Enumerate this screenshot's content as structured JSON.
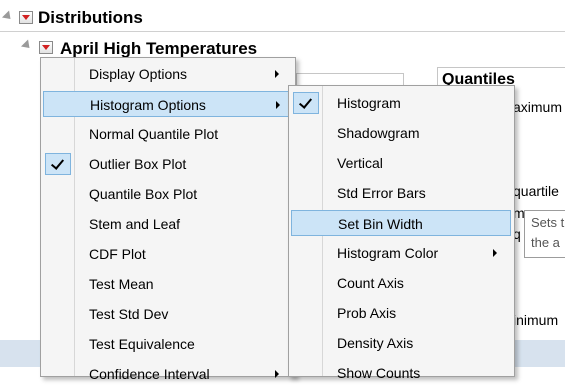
{
  "report": {
    "title": "Distributions",
    "subtitle": "April High Temperatures",
    "quantiles_title": "Quantiles",
    "bg_fragments": [
      "aximum",
      "quartile",
      "m",
      "q",
      "inimum"
    ]
  },
  "main_menu": {
    "items": [
      {
        "label": "Display Options",
        "submenu": true,
        "checked": false,
        "highlighted": false
      },
      {
        "label": "Histogram Options",
        "submenu": true,
        "checked": false,
        "highlighted": true
      },
      {
        "label": "Normal Quantile Plot",
        "submenu": false,
        "checked": false,
        "highlighted": false
      },
      {
        "label": "Outlier Box Plot",
        "submenu": false,
        "checked": true,
        "highlighted": false
      },
      {
        "label": "Quantile Box Plot",
        "submenu": false,
        "checked": false,
        "highlighted": false
      },
      {
        "label": "Stem and Leaf",
        "submenu": false,
        "checked": false,
        "highlighted": false
      },
      {
        "label": "CDF Plot",
        "submenu": false,
        "checked": false,
        "highlighted": false
      },
      {
        "label": "Test Mean",
        "submenu": false,
        "checked": false,
        "highlighted": false
      },
      {
        "label": "Test Std Dev",
        "submenu": false,
        "checked": false,
        "highlighted": false
      },
      {
        "label": "Test Equivalence",
        "submenu": false,
        "checked": false,
        "highlighted": false
      },
      {
        "label": "Confidence Interval",
        "submenu": true,
        "checked": false,
        "highlighted": false
      }
    ]
  },
  "sub_menu": {
    "items": [
      {
        "label": "Histogram",
        "submenu": false,
        "checked": true,
        "highlighted": false
      },
      {
        "label": "Shadowgram",
        "submenu": false,
        "checked": false,
        "highlighted": false
      },
      {
        "label": "Vertical",
        "submenu": false,
        "checked": false,
        "highlighted": false
      },
      {
        "label": "Std Error Bars",
        "submenu": false,
        "checked": false,
        "highlighted": false
      },
      {
        "label": "Set Bin Width",
        "submenu": false,
        "checked": false,
        "highlighted": true
      },
      {
        "label": "Histogram Color",
        "submenu": true,
        "checked": false,
        "highlighted": false
      },
      {
        "label": "Count Axis",
        "submenu": false,
        "checked": false,
        "highlighted": false
      },
      {
        "label": "Prob Axis",
        "submenu": false,
        "checked": false,
        "highlighted": false
      },
      {
        "label": "Density Axis",
        "submenu": false,
        "checked": false,
        "highlighted": false
      },
      {
        "label": "Show Counts",
        "submenu": false,
        "checked": false,
        "highlighted": false
      }
    ]
  },
  "tooltip": {
    "line1": "Sets t",
    "line2": "the a"
  },
  "colors": {
    "menu_bg": "#f5f5f5",
    "highlight": "#cce4f7",
    "highlight_border": "#7fb4de",
    "red_arrow": "#d21f1f"
  }
}
